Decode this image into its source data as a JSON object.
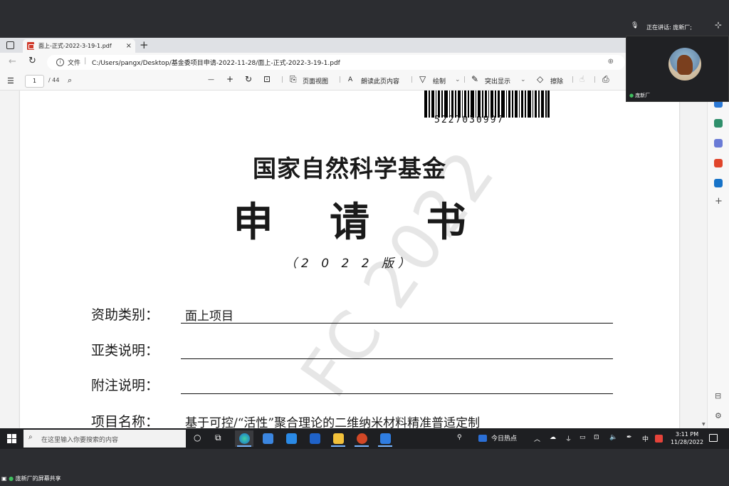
{
  "browser": {
    "tab_title": "面上-正式-2022-3-19-1.pdf",
    "tab_close": "×",
    "new_tab": "+",
    "url_prefix": "文件",
    "url_sep": "|",
    "url": "C:/Users/pangx/Desktop/基金委项目申请-2022-11-28/面上-正式-2022-3-19-1.pdf"
  },
  "pdf_toolbar": {
    "page_current": "1",
    "page_total": "/ 44",
    "zoom_out": "—",
    "zoom_in": "+",
    "page_view": "页面视图",
    "read_aloud": "朗读此页内容",
    "draw": "绘制",
    "highlight": "突出显示",
    "erase": "擦除"
  },
  "document": {
    "barcode_number": "5227030997",
    "title_line1": "国家自然科学基金",
    "title_line2": "申 请 书",
    "version": "（2 0 2 2 版）",
    "watermark": "FC 2022",
    "fields": [
      {
        "label": "资助类别：",
        "value": "面上项目"
      },
      {
        "label": "亚类说明：",
        "value": ""
      },
      {
        "label": "附注说明：",
        "value": ""
      },
      {
        "label": "项目名称：",
        "value": "基于可控/“活性”聚合理论的二维纳米材料精准普适定制"
      }
    ]
  },
  "meeting": {
    "speaker_status": "正在讲话: 庞新厂;",
    "participant_name": "庞新厂",
    "screen_share_label": "庞新厂的屏幕共享"
  },
  "taskbar": {
    "search_placeholder": "在这里输入你要搜索的内容",
    "news_label": "今日热点",
    "ime": "中",
    "time": "3:11 PM",
    "date": "11/28/2022"
  },
  "colors": {
    "pdf_red": "#d03a2b",
    "taskbar": "#1e1f22",
    "accent": "#7ab7ff"
  }
}
